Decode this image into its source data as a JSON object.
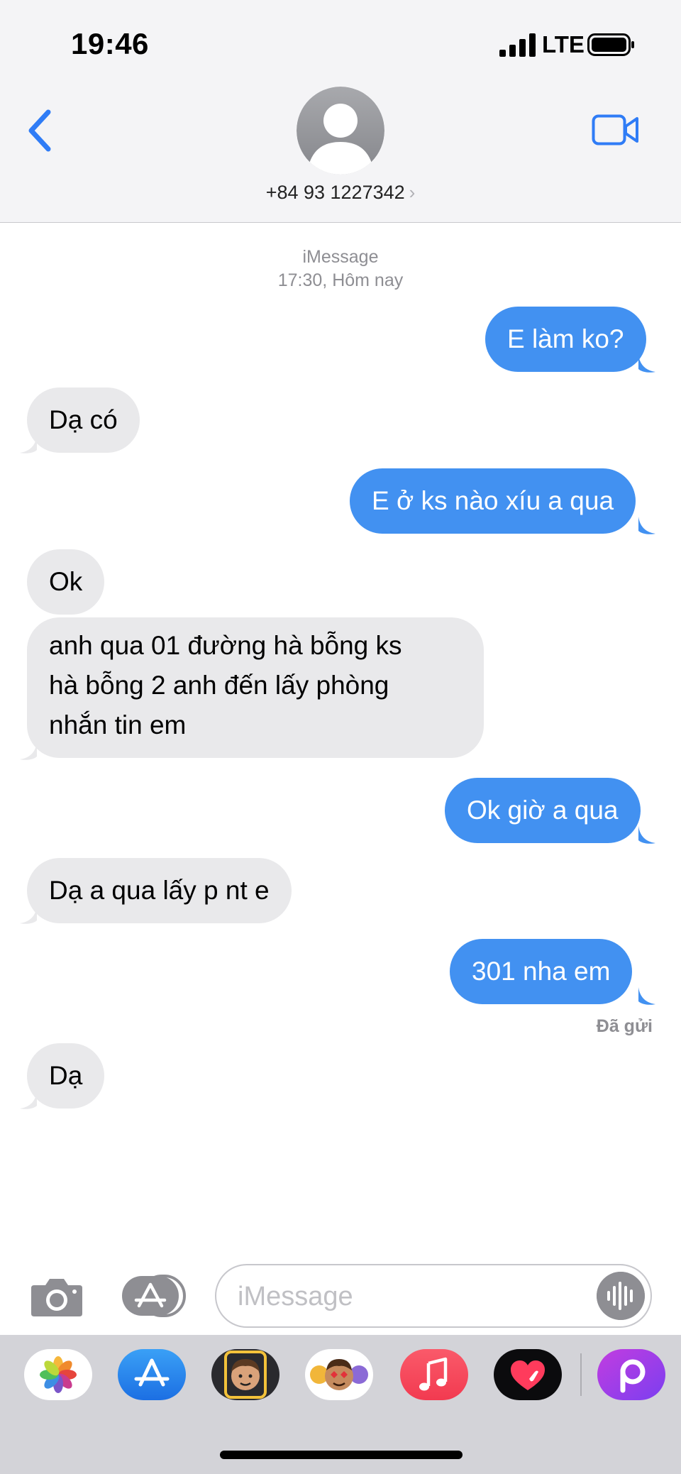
{
  "status_bar": {
    "time": "19:46",
    "network": "LTE",
    "icons": [
      "signal-icon",
      "battery-icon"
    ]
  },
  "header": {
    "back_icon": "chevron-left-icon",
    "contact": "+84 93 1227342",
    "contact_chevron": "›",
    "video_icon": "video-camera-icon"
  },
  "thread": {
    "service": "iMessage",
    "timestamp": "17:30, Hôm nay",
    "messages": [
      {
        "from": "me",
        "text": "E làm ko?"
      },
      {
        "from": "them",
        "text": "Dạ có"
      },
      {
        "from": "me",
        "text": "E ở ks nào xíu a qua"
      },
      {
        "from": "them",
        "text": "Ok"
      },
      {
        "from": "them",
        "text": "anh qua 01 đường  hà bỗng  ks\nhà bỗng 2 anh đến lấy phòng\nnhắn tin em"
      },
      {
        "from": "me",
        "text": "Ok giờ a qua"
      },
      {
        "from": "them",
        "text": "Dạ a qua lấy p nt e"
      },
      {
        "from": "me",
        "text": "301 nha em"
      },
      {
        "from": "them",
        "text": "Dạ"
      }
    ],
    "delivered": "Đã gửi"
  },
  "composer": {
    "placeholder": "iMessage",
    "icons": [
      "camera-icon",
      "app-store-icon",
      "audio-waveform-icon"
    ]
  },
  "app_tray": [
    "photos-icon",
    "app-store-icon",
    "memoji-icon",
    "animoji-icon",
    "music-icon",
    "digital-touch-icon",
    "picsart-icon"
  ],
  "colors": {
    "sent_bubble": "#4291f1",
    "received_bubble": "#e9e9eb",
    "accent": "#2f7cf6"
  }
}
